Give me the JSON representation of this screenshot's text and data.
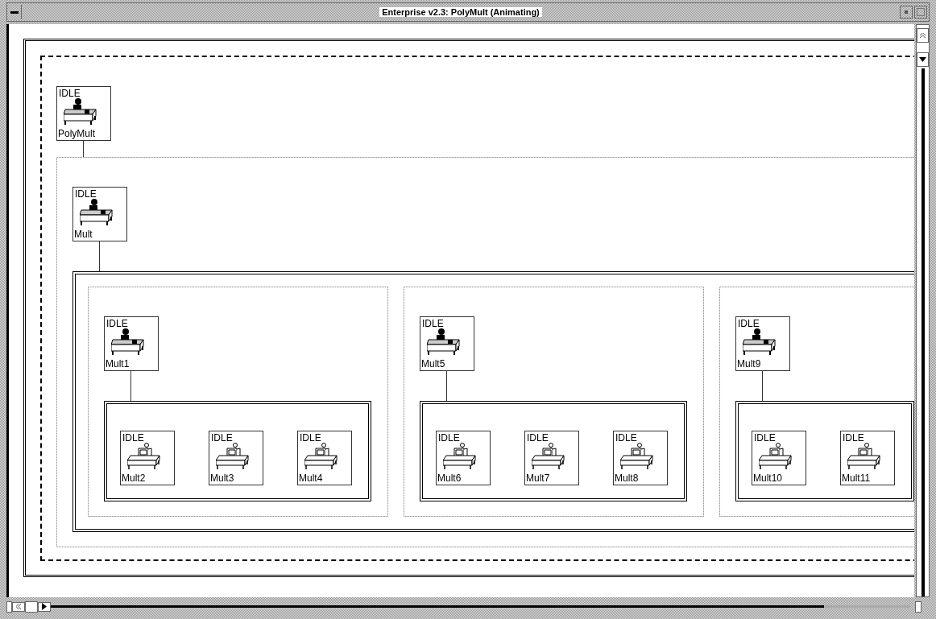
{
  "window": {
    "title": "Enterprise v2.3: PolyMult (Animating)"
  },
  "tree": {
    "status": "IDLE",
    "label": "PolyMult",
    "kind": "manager",
    "children": [
      {
        "status": "IDLE",
        "label": "Mult",
        "kind": "manager",
        "children": [
          {
            "status": "IDLE",
            "label": "Mult1",
            "kind": "manager",
            "children": [
              {
                "status": "IDLE",
                "label": "Mult2",
                "kind": "worker"
              },
              {
                "status": "IDLE",
                "label": "Mult3",
                "kind": "worker"
              },
              {
                "status": "IDLE",
                "label": "Mult4",
                "kind": "worker"
              }
            ]
          },
          {
            "status": "IDLE",
            "label": "Mult5",
            "kind": "manager",
            "children": [
              {
                "status": "IDLE",
                "label": "Mult6",
                "kind": "worker"
              },
              {
                "status": "IDLE",
                "label": "Mult7",
                "kind": "worker"
              },
              {
                "status": "IDLE",
                "label": "Mult8",
                "kind": "worker"
              }
            ]
          },
          {
            "status": "IDLE",
            "label": "Mult9",
            "kind": "manager",
            "children": [
              {
                "status": "IDLE",
                "label": "Mult10",
                "kind": "worker"
              },
              {
                "status": "IDLE",
                "label": "Mult11",
                "kind": "worker"
              }
            ]
          }
        ]
      }
    ]
  }
}
